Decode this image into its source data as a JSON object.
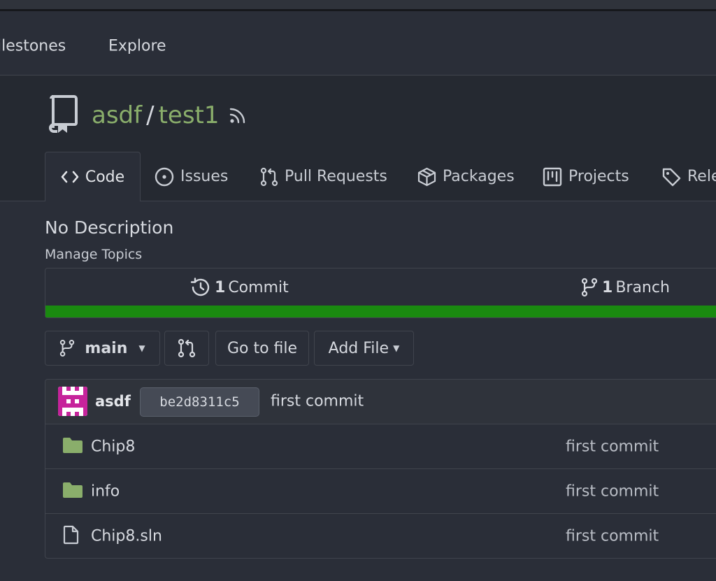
{
  "nav": {
    "items": [
      "ilestones",
      "Explore"
    ]
  },
  "repo": {
    "owner": "asdf",
    "separator": "/",
    "name": "test1"
  },
  "tabs": [
    {
      "label": "Code",
      "icon": "code-icon"
    },
    {
      "label": "Issues",
      "icon": "issue-icon"
    },
    {
      "label": "Pull Requests",
      "icon": "pull-request-icon"
    },
    {
      "label": "Packages",
      "icon": "package-icon"
    },
    {
      "label": "Projects",
      "icon": "project-icon"
    },
    {
      "label": "Rele",
      "icon": "tag-icon"
    }
  ],
  "description": "No Description",
  "topics_link": "Manage Topics",
  "stats": {
    "commits_count": "1",
    "commits_label": "Commit",
    "branches_count": "1",
    "branches_label": "Branch"
  },
  "language_bar_color": "#1a8a10",
  "toolbar": {
    "branch": "main",
    "goto_file": "Go to file",
    "add_file": "Add File"
  },
  "latest_commit": {
    "author": "asdf",
    "sha": "be2d8311c5",
    "message": "first commit"
  },
  "files": [
    {
      "name": "Chip8",
      "type": "folder",
      "message": "first commit"
    },
    {
      "name": "info",
      "type": "folder",
      "message": "first commit"
    },
    {
      "name": "Chip8.sln",
      "type": "file",
      "message": "first commit"
    }
  ],
  "colors": {
    "accent_link": "#8aae6b",
    "background": "#2a2e38",
    "folder": "#8aae6b"
  }
}
